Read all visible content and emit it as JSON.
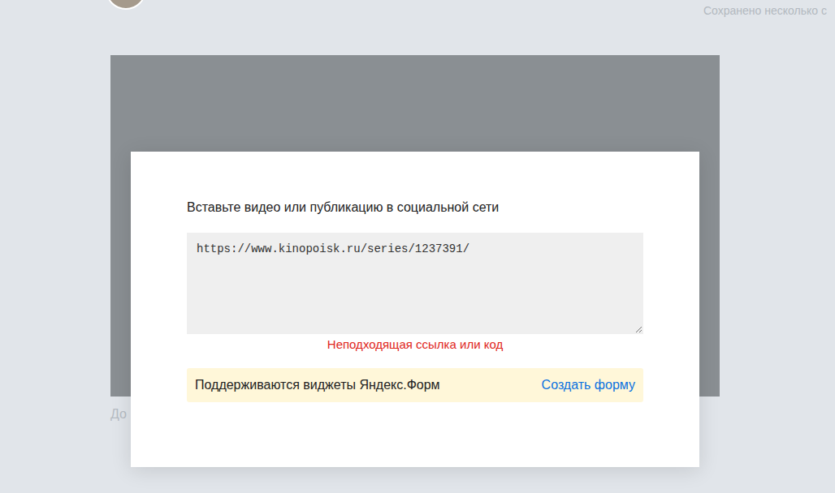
{
  "header": {
    "save_status": "Сохранено несколько с"
  },
  "caption": "До",
  "modal": {
    "title": "Вставьте видео или публикацию в социальной сети",
    "field": {
      "value": "https://www.kinopoisk.ru/series/1237391/",
      "error": "Неподходящая ссылка или код"
    },
    "notice": {
      "text": "Поддерживаются виджеты Яндекс.Форм",
      "link": "Создать форму"
    }
  }
}
